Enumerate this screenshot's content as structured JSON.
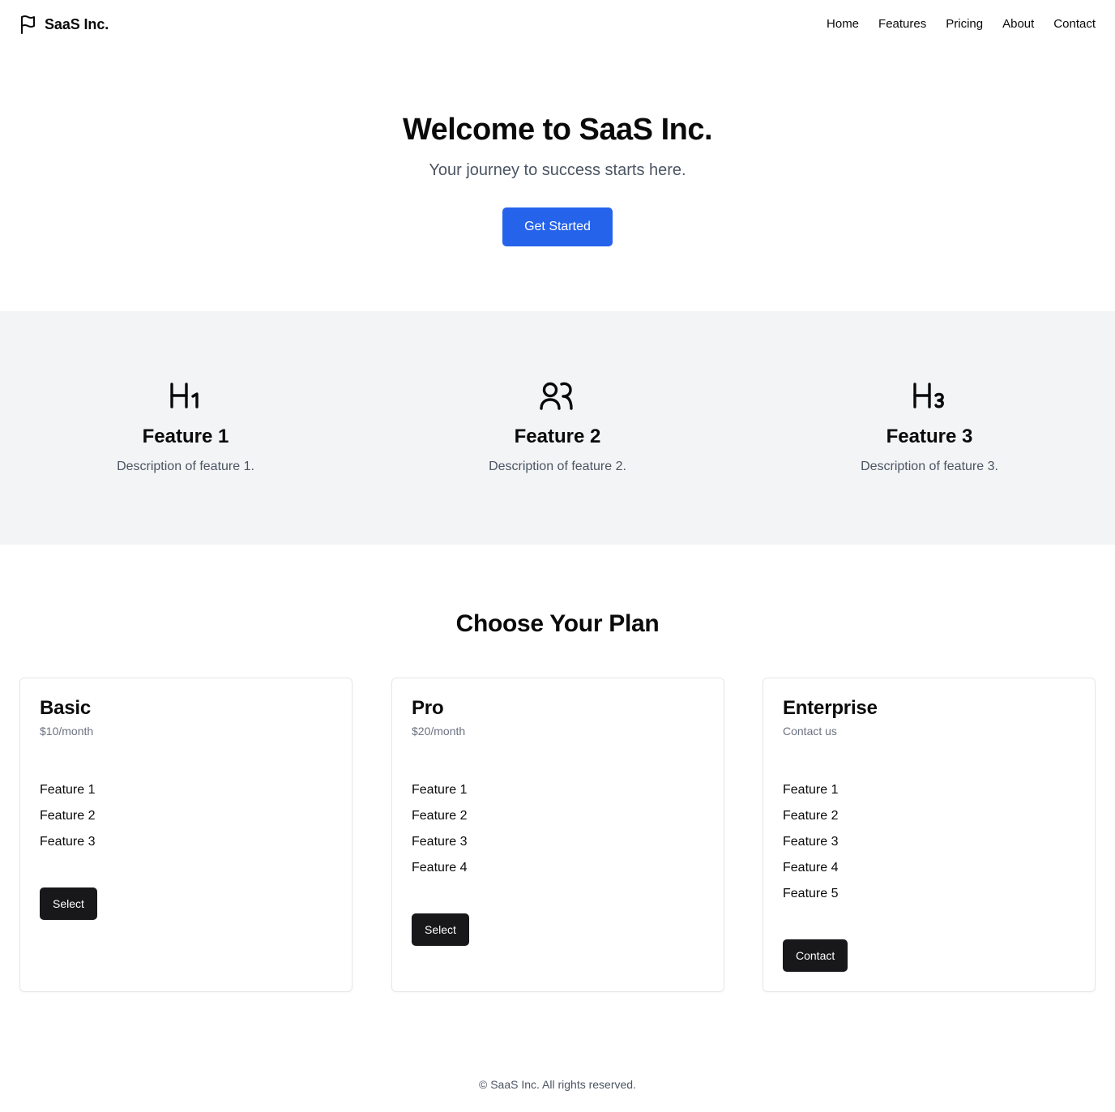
{
  "header": {
    "brand_name": "SaaS Inc.",
    "brand_icon": "flag-icon",
    "nav": [
      "Home",
      "Features",
      "Pricing",
      "About",
      "Contact"
    ]
  },
  "hero": {
    "title": "Welcome to SaaS Inc.",
    "subtitle": "Your journey to success starts here.",
    "cta_label": "Get Started",
    "cta_color": "#2563eb"
  },
  "features": [
    {
      "icon": "heading-1-icon",
      "title": "Feature 1",
      "description": "Description of feature 1."
    },
    {
      "icon": "users-icon",
      "title": "Feature 2",
      "description": "Description of feature 2."
    },
    {
      "icon": "heading-3-icon",
      "title": "Feature 3",
      "description": "Description of feature 3."
    }
  ],
  "pricing": {
    "title": "Choose Your Plan",
    "plans": [
      {
        "name": "Basic",
        "price": "$10/month",
        "features": [
          "Feature 1",
          "Feature 2",
          "Feature 3"
        ],
        "button": "Select"
      },
      {
        "name": "Pro",
        "price": "$20/month",
        "features": [
          "Feature 1",
          "Feature 2",
          "Feature 3",
          "Feature 4"
        ],
        "button": "Select"
      },
      {
        "name": "Enterprise",
        "price": "Contact us",
        "features": [
          "Feature 1",
          "Feature 2",
          "Feature 3",
          "Feature 4",
          "Feature 5"
        ],
        "button": "Contact"
      }
    ]
  },
  "footer": {
    "text": "© SaaS Inc. All rights reserved."
  }
}
